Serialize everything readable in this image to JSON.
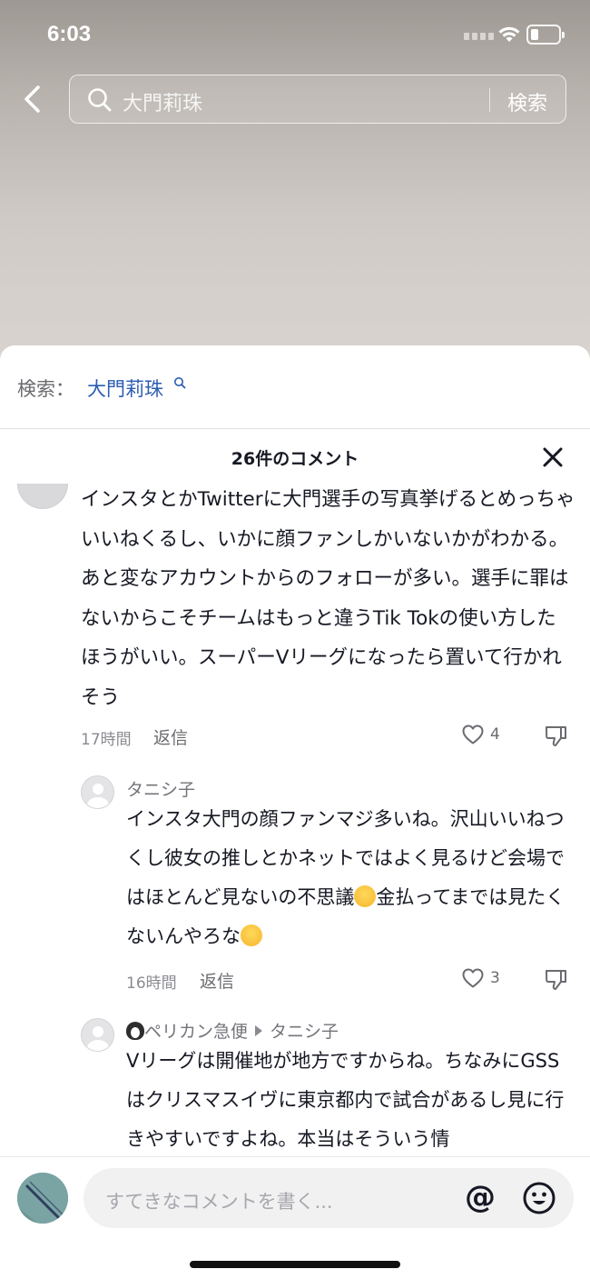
{
  "status_bar": {
    "time": "6:03"
  },
  "search": {
    "query": "大門莉珠",
    "submit_label": "検索"
  },
  "suggestion": {
    "label": "検索：",
    "link": "大門莉珠"
  },
  "comments": {
    "title": "26件のコメント",
    "items": [
      {
        "text": "インスタとかTwitterに大門選手の写真挙げるとめっちゃいいねくるし、いかに顔ファンしかいないかがわかる。あと変なアカウントからのフォローが多い。選手に罪はないからこそチームはもっと違うTik Tokの使い方したほうがいい。スーパーVリーグになったら置いて行かれそう",
        "time": "17時間",
        "reply_label": "返信",
        "likes": "4"
      }
    ],
    "replies": [
      {
        "username": "タニシ子",
        "text_part1": "インスタ大門の顔ファンマジ多いね。沢山いいねつくし彼女の推しとかネットではよく見るけど会場ではほとんど見ないの不思議",
        "text_part2": "金払ってまでは見たくないんやろな",
        "time": "16時間",
        "reply_label": "返信",
        "likes": "3"
      },
      {
        "username": "ペリカン急便",
        "reply_to": "タニシ子",
        "text": "Vリーグは開催地が地方ですからね。ちなみにGSSはクリスマスイヴに東京都内で試合があるし見に行きやすいですよね。本当はそういう情"
      }
    ]
  },
  "input": {
    "placeholder": "すてきなコメントを書く...",
    "at_symbol": "@"
  },
  "icons": {
    "back": "chevron-left-icon",
    "search": "search-icon",
    "close": "close-icon",
    "like": "heart-icon",
    "dislike": "thumbs-down-icon",
    "emoji": "emoji-icon"
  },
  "colors": {
    "link": "#2b5db3",
    "text": "#161823",
    "muted": "#8a8b91"
  }
}
